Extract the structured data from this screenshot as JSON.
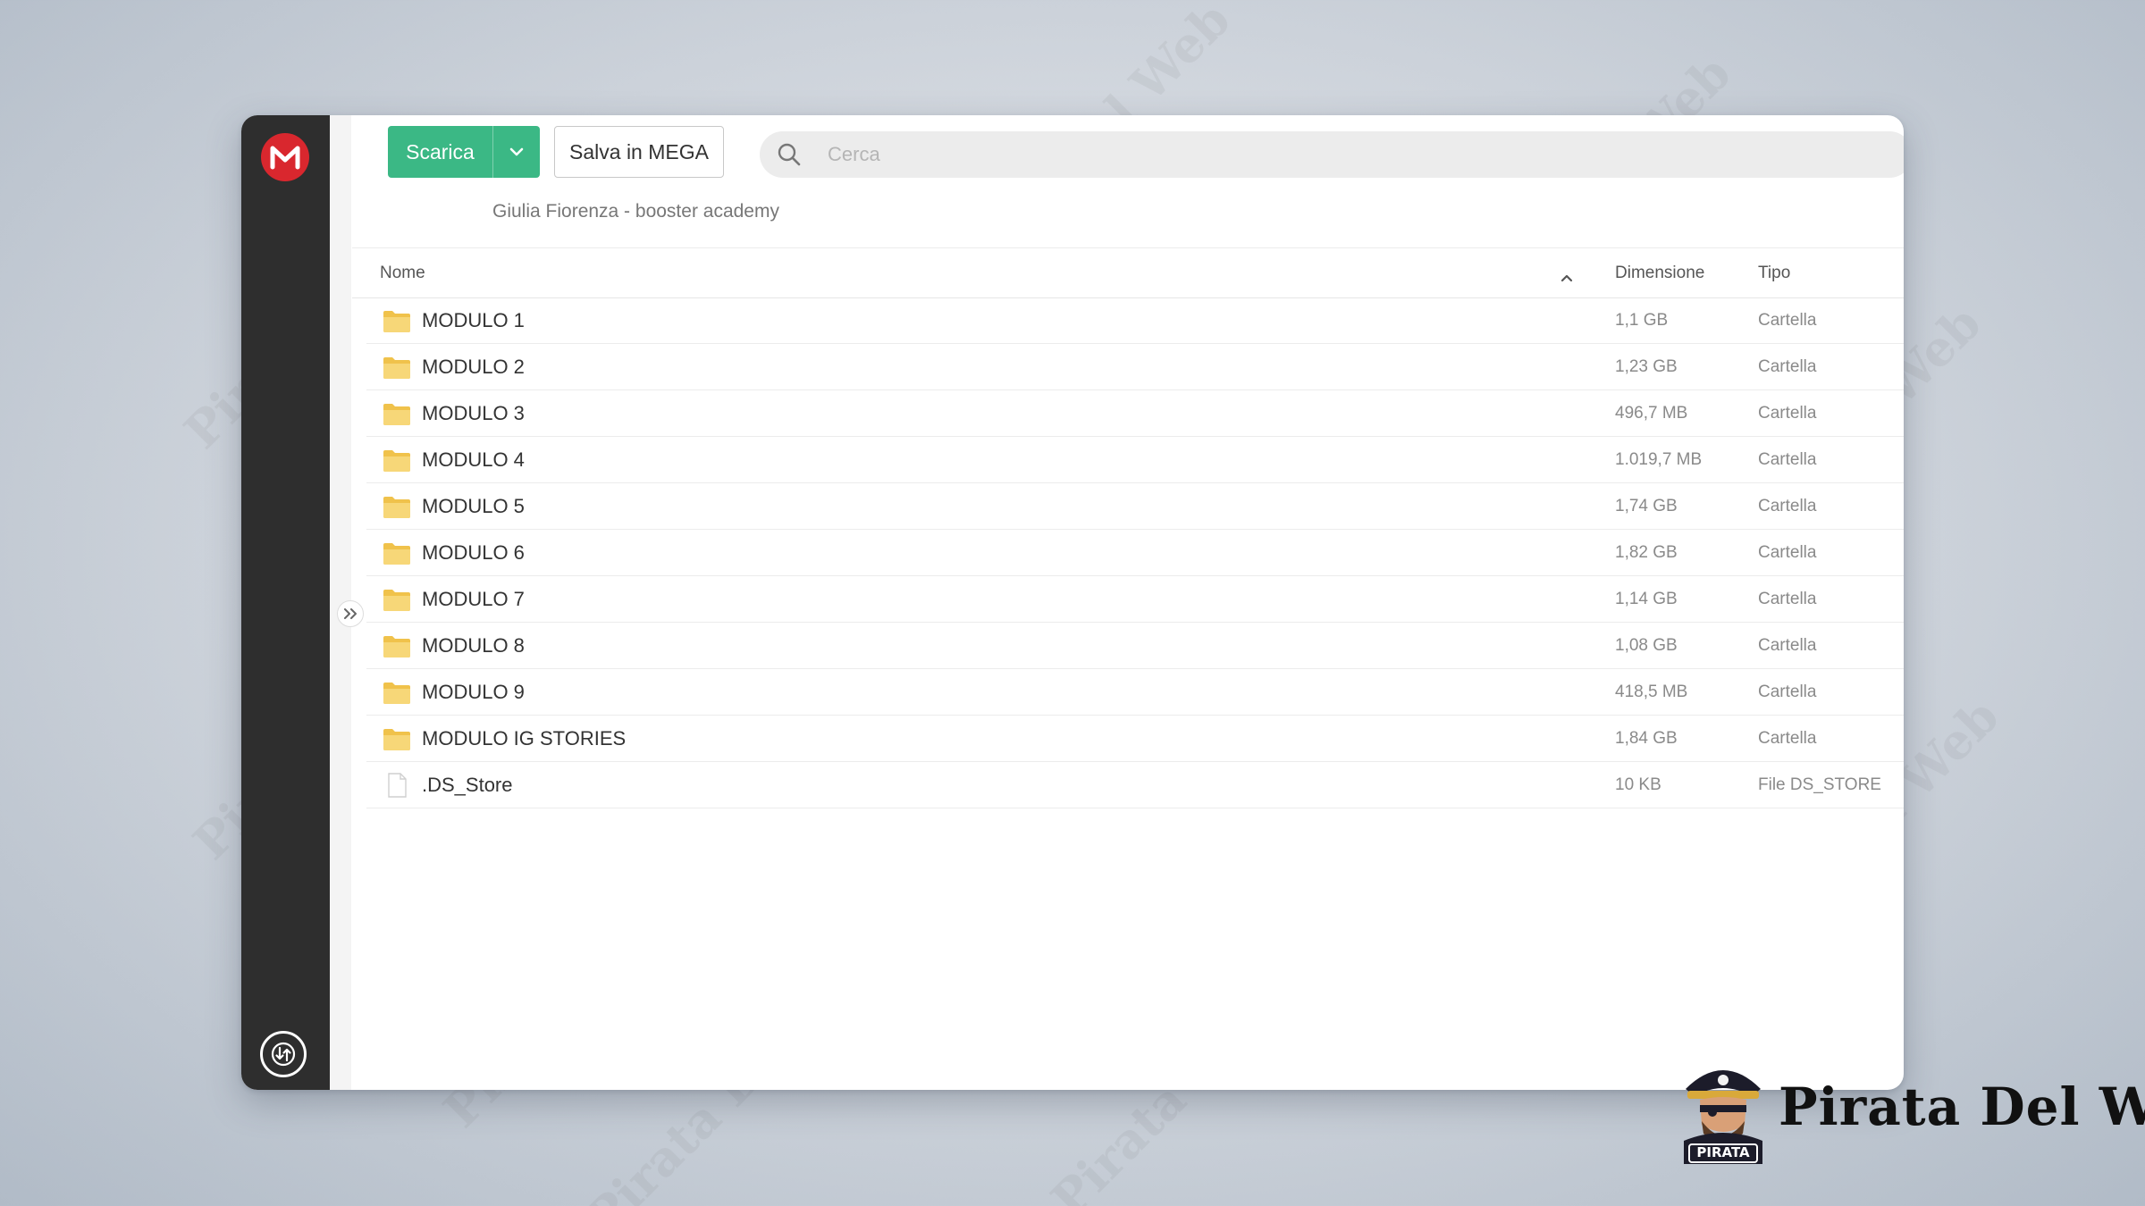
{
  "app": {
    "logo_letter": "M",
    "accent": "#d9272e"
  },
  "toolbar": {
    "download_label": "Scarica",
    "save_label": "Salva in MEGA",
    "download_color": "#3bb885"
  },
  "search": {
    "placeholder": "Cerca"
  },
  "breadcrumb": {
    "label": "Giulia Fiorenza - booster academy"
  },
  "table": {
    "columns": {
      "name": "Nome",
      "size": "Dimensione",
      "type": "Tipo"
    },
    "rows": [
      {
        "name": "MODULO 1",
        "size": "1,1 GB",
        "type": "Cartella",
        "icon": "folder-icon"
      },
      {
        "name": "MODULO 2",
        "size": "1,23 GB",
        "type": "Cartella",
        "icon": "folder-icon"
      },
      {
        "name": "MODULO 3",
        "size": "496,7 MB",
        "type": "Cartella",
        "icon": "folder-icon"
      },
      {
        "name": "MODULO 4",
        "size": "1.019,7 MB",
        "type": "Cartella",
        "icon": "folder-icon"
      },
      {
        "name": "MODULO 5",
        "size": "1,74 GB",
        "type": "Cartella",
        "icon": "folder-icon"
      },
      {
        "name": "MODULO 6",
        "size": "1,82 GB",
        "type": "Cartella",
        "icon": "folder-icon"
      },
      {
        "name": "MODULO 7",
        "size": "1,14 GB",
        "type": "Cartella",
        "icon": "folder-icon"
      },
      {
        "name": "MODULO 8",
        "size": "1,08 GB",
        "type": "Cartella",
        "icon": "folder-icon"
      },
      {
        "name": "MODULO 9",
        "size": "418,5 MB",
        "type": "Cartella",
        "icon": "folder-icon"
      },
      {
        "name": "MODULO IG STORIES",
        "size": "1,84 GB",
        "type": "Cartella",
        "icon": "folder-icon"
      },
      {
        "name": ".DS_Store",
        "size": "10 KB",
        "type": "File DS_STORE",
        "icon": "file-icon"
      }
    ]
  },
  "watermark": {
    "text": "Pirata Del Web",
    "badge_label": "PIRATA"
  }
}
